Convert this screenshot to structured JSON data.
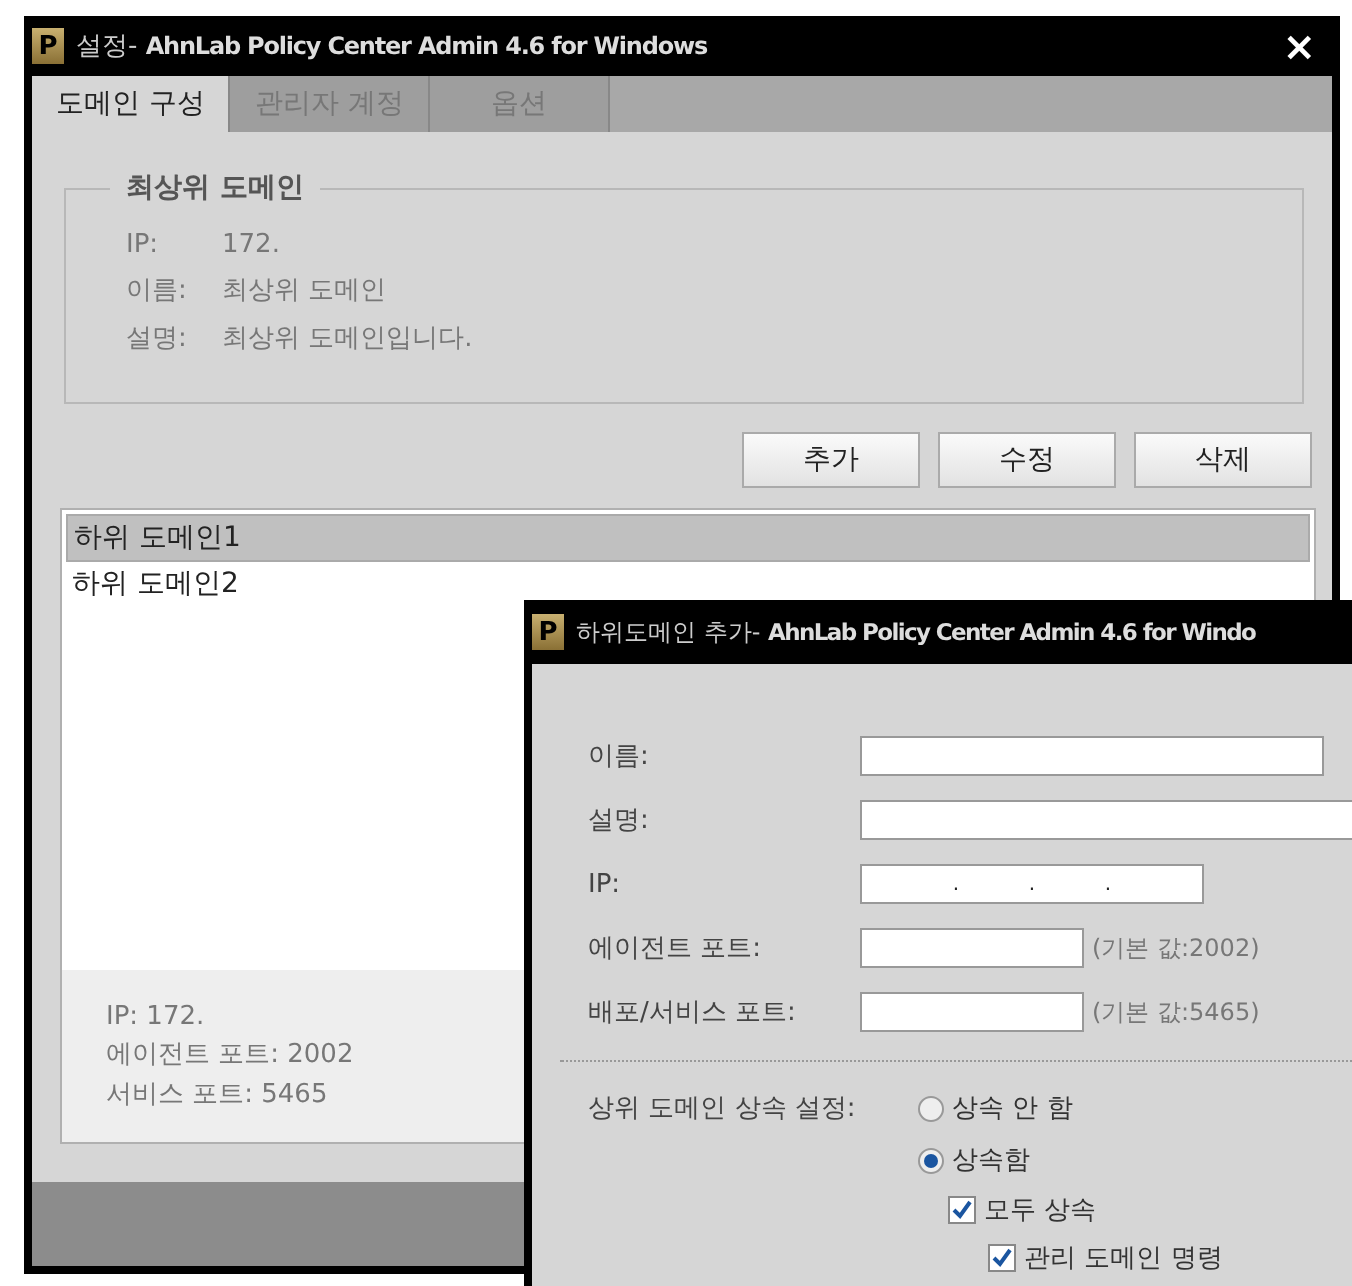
{
  "window": {
    "logo": "P",
    "title": "설정- **AhnLab Policy Center Admin 4.6 for Windows**",
    "close": "×"
  },
  "tabs": [
    {
      "label": "도메인 구성",
      "selected": true
    },
    {
      "label": "관리자 계정",
      "selected": false
    },
    {
      "label": "옵션",
      "selected": false
    }
  ],
  "top_domain": {
    "title": "최상위 도메인",
    "rows": [
      {
        "label": "IP:",
        "value": "172."
      },
      {
        "label": "이름:",
        "value": "최상위 도메인"
      },
      {
        "label": "설명:",
        "value": "최상위 도메인입니다."
      }
    ]
  },
  "buttons": [
    "추가",
    "수정",
    "삭제"
  ],
  "subdomains": [
    {
      "label": "하위 도메인1",
      "selected": true
    },
    {
      "label": "하위 도메인2",
      "selected": false
    }
  ],
  "details": [
    "IP: 172.",
    "에이전트 포트: 2002",
    "서비스 포트: 5465"
  ],
  "dialog": {
    "logo": "P",
    "title": "하위도메인 추가- **AhnLab Policy Center Admin 4.6 for Windo**",
    "fields": [
      {
        "label": "이름:",
        "kind": "long"
      },
      {
        "label": "설명:",
        "kind": "wide"
      },
      {
        "label": "IP:",
        "kind": "ip",
        "separators": [
          ".",
          ".",
          "."
        ]
      },
      {
        "label": "에이전트 포트:",
        "kind": "port",
        "hint": "(기본 값:2002)"
      },
      {
        "label": "배포/서비스 포트:",
        "kind": "port",
        "hint": "(기본 값:5465)"
      }
    ],
    "inherit_label": "상위 도메인 상속 설정:",
    "inherit_options": [
      {
        "label": "상속 안 함",
        "selected": false
      },
      {
        "label": "상속함",
        "selected": true
      }
    ],
    "checks": [
      {
        "label": "모두 상속",
        "checked": true,
        "children": [
          {
            "label": "관리 도메인 명령",
            "checked": true
          }
        ]
      }
    ]
  }
}
